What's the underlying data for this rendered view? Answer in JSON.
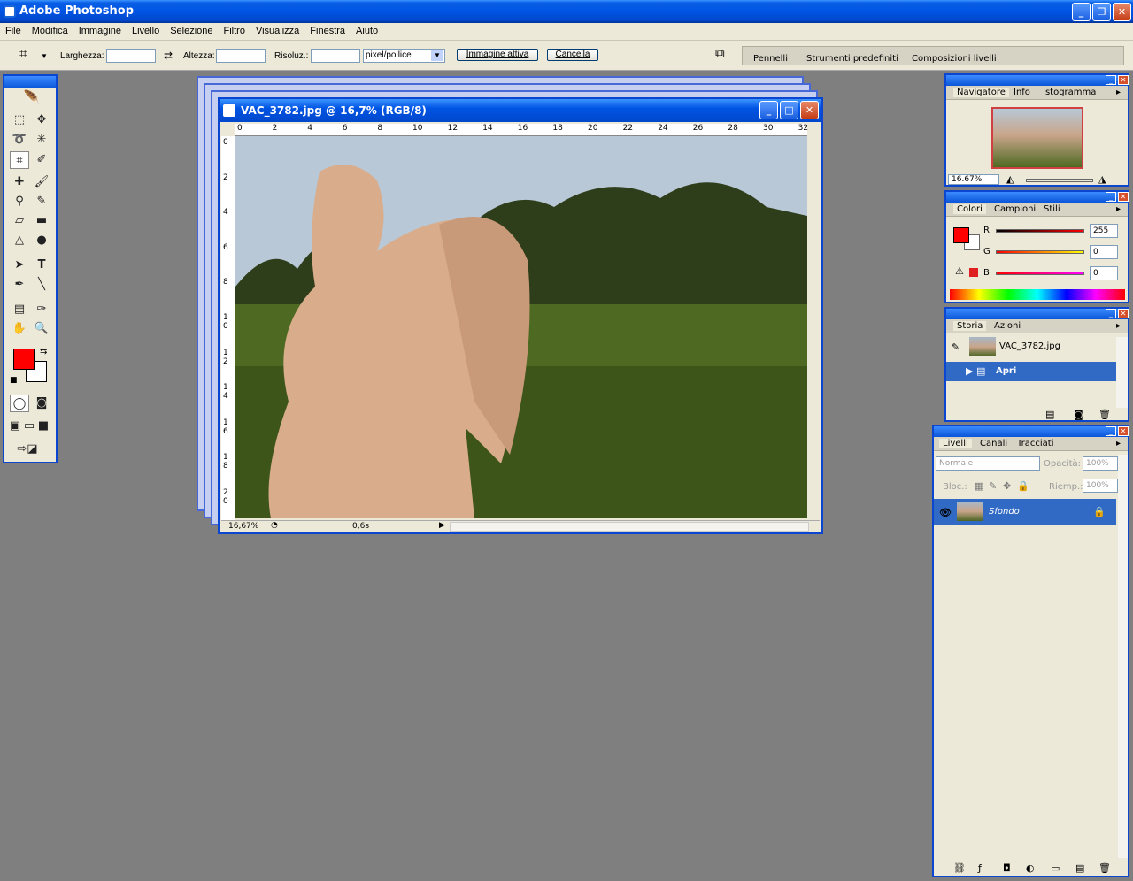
{
  "app": {
    "title": "Adobe Photoshop",
    "icon": "photoshop-logo-icon"
  },
  "menu": [
    "File",
    "Modifica",
    "Immagine",
    "Livello",
    "Selezione",
    "Filtro",
    "Visualizza",
    "Finestra",
    "Aiuto"
  ],
  "options": {
    "width_label": "Larghezza:",
    "width_value": "",
    "height_label": "Altezza:",
    "height_value": "",
    "res_label": "Risoluz.:",
    "res_value": "",
    "unit": "pixel/pollice",
    "front_image": "Immagine attiva",
    "clear": "Cancella"
  },
  "well": [
    "Pennelli",
    "Strumenti predefiniti",
    "Composizioni livelli"
  ],
  "colors": {
    "foreground": "#ff0000",
    "background": "#ffffff",
    "title_blue": "#0054e3",
    "selection": "#316ac5"
  },
  "document": {
    "title": "VAC_3782.jpg @ 16,7% (RGB/8)",
    "ruler_h": [
      "0",
      "2",
      "4",
      "6",
      "8",
      "10",
      "12",
      "14",
      "16",
      "18",
      "20",
      "22",
      "24",
      "26",
      "28",
      "30",
      "32"
    ],
    "ruler_v": [
      "0",
      "2",
      "4",
      "6",
      "8",
      "1 0",
      "1 2",
      "1 4",
      "1 6",
      "1 8",
      "2 0"
    ],
    "zoom": "16,67%",
    "info": "0,6s"
  },
  "navigator": {
    "tabs": [
      "Navigatore",
      "Info",
      "Istogramma"
    ],
    "zoom": "16.67%"
  },
  "color_panel": {
    "tabs": [
      "Colori",
      "Campioni",
      "Stili"
    ],
    "r_label": "R",
    "g_label": "G",
    "b_label": "B",
    "r": "255",
    "g": "0",
    "b": "0"
  },
  "history": {
    "tabs": [
      "Storia",
      "Azioni"
    ],
    "snapshot": "VAC_3782.jpg",
    "step": "Apri"
  },
  "layers": {
    "tabs": [
      "Livelli",
      "Canali",
      "Tracciati"
    ],
    "blend": "Normale",
    "opacity_label": "Opacità:",
    "opacity": "100%",
    "lock_label": "Bloc.:",
    "fill_label": "Riemp.:",
    "fill": "100%",
    "layer_name": "Sfondo"
  }
}
